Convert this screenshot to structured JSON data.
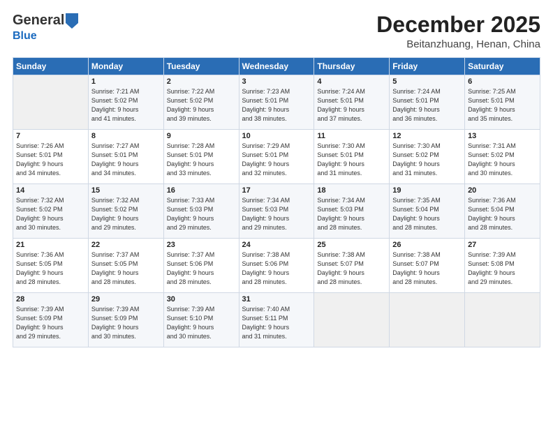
{
  "header": {
    "logo": {
      "general": "General",
      "blue": "Blue"
    },
    "title": "December 2025",
    "location": "Beitanzhuang, Henan, China"
  },
  "days_header": [
    "Sunday",
    "Monday",
    "Tuesday",
    "Wednesday",
    "Thursday",
    "Friday",
    "Saturday"
  ],
  "weeks": [
    [
      {
        "day": "",
        "info": ""
      },
      {
        "day": "1",
        "info": "Sunrise: 7:21 AM\nSunset: 5:02 PM\nDaylight: 9 hours\nand 41 minutes."
      },
      {
        "day": "2",
        "info": "Sunrise: 7:22 AM\nSunset: 5:02 PM\nDaylight: 9 hours\nand 39 minutes."
      },
      {
        "day": "3",
        "info": "Sunrise: 7:23 AM\nSunset: 5:01 PM\nDaylight: 9 hours\nand 38 minutes."
      },
      {
        "day": "4",
        "info": "Sunrise: 7:24 AM\nSunset: 5:01 PM\nDaylight: 9 hours\nand 37 minutes."
      },
      {
        "day": "5",
        "info": "Sunrise: 7:24 AM\nSunset: 5:01 PM\nDaylight: 9 hours\nand 36 minutes."
      },
      {
        "day": "6",
        "info": "Sunrise: 7:25 AM\nSunset: 5:01 PM\nDaylight: 9 hours\nand 35 minutes."
      }
    ],
    [
      {
        "day": "7",
        "info": "Sunrise: 7:26 AM\nSunset: 5:01 PM\nDaylight: 9 hours\nand 34 minutes."
      },
      {
        "day": "8",
        "info": "Sunrise: 7:27 AM\nSunset: 5:01 PM\nDaylight: 9 hours\nand 34 minutes."
      },
      {
        "day": "9",
        "info": "Sunrise: 7:28 AM\nSunset: 5:01 PM\nDaylight: 9 hours\nand 33 minutes."
      },
      {
        "day": "10",
        "info": "Sunrise: 7:29 AM\nSunset: 5:01 PM\nDaylight: 9 hours\nand 32 minutes."
      },
      {
        "day": "11",
        "info": "Sunrise: 7:30 AM\nSunset: 5:01 PM\nDaylight: 9 hours\nand 31 minutes."
      },
      {
        "day": "12",
        "info": "Sunrise: 7:30 AM\nSunset: 5:02 PM\nDaylight: 9 hours\nand 31 minutes."
      },
      {
        "day": "13",
        "info": "Sunrise: 7:31 AM\nSunset: 5:02 PM\nDaylight: 9 hours\nand 30 minutes."
      }
    ],
    [
      {
        "day": "14",
        "info": "Sunrise: 7:32 AM\nSunset: 5:02 PM\nDaylight: 9 hours\nand 30 minutes."
      },
      {
        "day": "15",
        "info": "Sunrise: 7:32 AM\nSunset: 5:02 PM\nDaylight: 9 hours\nand 29 minutes."
      },
      {
        "day": "16",
        "info": "Sunrise: 7:33 AM\nSunset: 5:03 PM\nDaylight: 9 hours\nand 29 minutes."
      },
      {
        "day": "17",
        "info": "Sunrise: 7:34 AM\nSunset: 5:03 PM\nDaylight: 9 hours\nand 29 minutes."
      },
      {
        "day": "18",
        "info": "Sunrise: 7:34 AM\nSunset: 5:03 PM\nDaylight: 9 hours\nand 28 minutes."
      },
      {
        "day": "19",
        "info": "Sunrise: 7:35 AM\nSunset: 5:04 PM\nDaylight: 9 hours\nand 28 minutes."
      },
      {
        "day": "20",
        "info": "Sunrise: 7:36 AM\nSunset: 5:04 PM\nDaylight: 9 hours\nand 28 minutes."
      }
    ],
    [
      {
        "day": "21",
        "info": "Sunrise: 7:36 AM\nSunset: 5:05 PM\nDaylight: 9 hours\nand 28 minutes."
      },
      {
        "day": "22",
        "info": "Sunrise: 7:37 AM\nSunset: 5:05 PM\nDaylight: 9 hours\nand 28 minutes."
      },
      {
        "day": "23",
        "info": "Sunrise: 7:37 AM\nSunset: 5:06 PM\nDaylight: 9 hours\nand 28 minutes."
      },
      {
        "day": "24",
        "info": "Sunrise: 7:38 AM\nSunset: 5:06 PM\nDaylight: 9 hours\nand 28 minutes."
      },
      {
        "day": "25",
        "info": "Sunrise: 7:38 AM\nSunset: 5:07 PM\nDaylight: 9 hours\nand 28 minutes."
      },
      {
        "day": "26",
        "info": "Sunrise: 7:38 AM\nSunset: 5:07 PM\nDaylight: 9 hours\nand 28 minutes."
      },
      {
        "day": "27",
        "info": "Sunrise: 7:39 AM\nSunset: 5:08 PM\nDaylight: 9 hours\nand 29 minutes."
      }
    ],
    [
      {
        "day": "28",
        "info": "Sunrise: 7:39 AM\nSunset: 5:09 PM\nDaylight: 9 hours\nand 29 minutes."
      },
      {
        "day": "29",
        "info": "Sunrise: 7:39 AM\nSunset: 5:09 PM\nDaylight: 9 hours\nand 30 minutes."
      },
      {
        "day": "30",
        "info": "Sunrise: 7:39 AM\nSunset: 5:10 PM\nDaylight: 9 hours\nand 30 minutes."
      },
      {
        "day": "31",
        "info": "Sunrise: 7:40 AM\nSunset: 5:11 PM\nDaylight: 9 hours\nand 31 minutes."
      },
      {
        "day": "",
        "info": ""
      },
      {
        "day": "",
        "info": ""
      },
      {
        "day": "",
        "info": ""
      }
    ]
  ]
}
